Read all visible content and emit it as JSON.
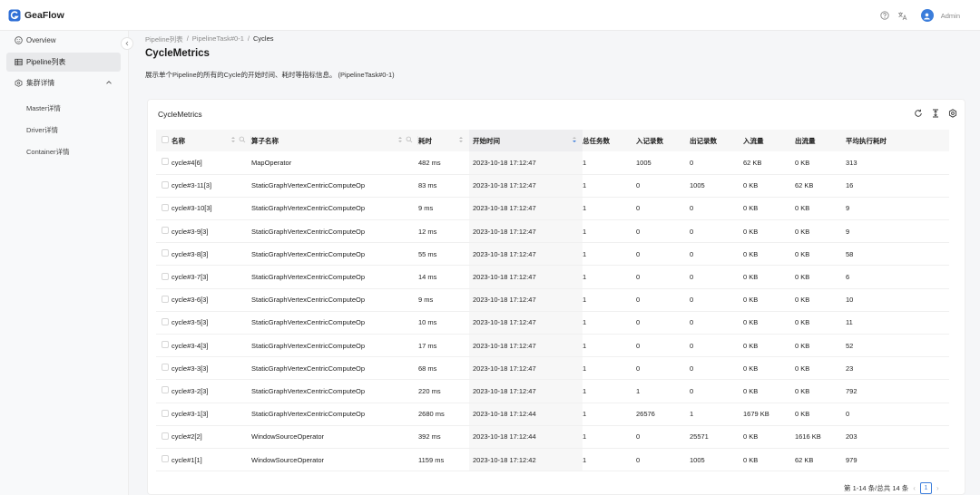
{
  "app": {
    "name": "GeaFlow"
  },
  "user": {
    "name": "Admin"
  },
  "sidebar": {
    "items": [
      {
        "label": "Overview",
        "icon": "smile-icon"
      },
      {
        "label": "Pipeline列表",
        "icon": "table-icon"
      },
      {
        "label": "集群详情",
        "icon": "cluster-icon"
      }
    ],
    "sub_items": [
      "Master详情",
      "Driver详情",
      "Container详情"
    ]
  },
  "breadcrumb": [
    "Pipeline列表",
    "PipelineTask#0-1",
    "Cycles"
  ],
  "page": {
    "title": "CycleMetrics",
    "description": "展示单个Pipeline的所有的Cycle的开始时间、耗时等指标信息。 (PipelineTask#0-1)"
  },
  "card": {
    "title": "CycleMetrics"
  },
  "table": {
    "headers": [
      "名称",
      "算子名称",
      "耗时",
      "开始时间",
      "总任务数",
      "入记录数",
      "出记录数",
      "入流量",
      "出流量",
      "平均执行耗时"
    ],
    "rows": [
      [
        "cycle#4[6]",
        "MapOperator",
        "482 ms",
        "2023-10-18 17:12:47",
        "1",
        "1005",
        "0",
        "62 KB",
        "0 KB",
        "313"
      ],
      [
        "cycle#3-11[3]",
        "StaticGraphVertexCentricComputeOp",
        "83 ms",
        "2023-10-18 17:12:47",
        "1",
        "0",
        "1005",
        "0 KB",
        "62 KB",
        "16"
      ],
      [
        "cycle#3-10[3]",
        "StaticGraphVertexCentricComputeOp",
        "9 ms",
        "2023-10-18 17:12:47",
        "1",
        "0",
        "0",
        "0 KB",
        "0 KB",
        "9"
      ],
      [
        "cycle#3-9[3]",
        "StaticGraphVertexCentricComputeOp",
        "12 ms",
        "2023-10-18 17:12:47",
        "1",
        "0",
        "0",
        "0 KB",
        "0 KB",
        "9"
      ],
      [
        "cycle#3-8[3]",
        "StaticGraphVertexCentricComputeOp",
        "55 ms",
        "2023-10-18 17:12:47",
        "1",
        "0",
        "0",
        "0 KB",
        "0 KB",
        "58"
      ],
      [
        "cycle#3-7[3]",
        "StaticGraphVertexCentricComputeOp",
        "14 ms",
        "2023-10-18 17:12:47",
        "1",
        "0",
        "0",
        "0 KB",
        "0 KB",
        "6"
      ],
      [
        "cycle#3-6[3]",
        "StaticGraphVertexCentricComputeOp",
        "9 ms",
        "2023-10-18 17:12:47",
        "1",
        "0",
        "0",
        "0 KB",
        "0 KB",
        "10"
      ],
      [
        "cycle#3-5[3]",
        "StaticGraphVertexCentricComputeOp",
        "10 ms",
        "2023-10-18 17:12:47",
        "1",
        "0",
        "0",
        "0 KB",
        "0 KB",
        "11"
      ],
      [
        "cycle#3-4[3]",
        "StaticGraphVertexCentricComputeOp",
        "17 ms",
        "2023-10-18 17:12:47",
        "1",
        "0",
        "0",
        "0 KB",
        "0 KB",
        "52"
      ],
      [
        "cycle#3-3[3]",
        "StaticGraphVertexCentricComputeOp",
        "68 ms",
        "2023-10-18 17:12:47",
        "1",
        "0",
        "0",
        "0 KB",
        "0 KB",
        "23"
      ],
      [
        "cycle#3-2[3]",
        "StaticGraphVertexCentricComputeOp",
        "220 ms",
        "2023-10-18 17:12:47",
        "1",
        "1",
        "0",
        "0 KB",
        "0 KB",
        "792"
      ],
      [
        "cycle#3-1[3]",
        "StaticGraphVertexCentricComputeOp",
        "2680 ms",
        "2023-10-18 17:12:44",
        "1",
        "26576",
        "1",
        "1679 KB",
        "0 KB",
        "0"
      ],
      [
        "cycle#2[2]",
        "WindowSourceOperator",
        "392 ms",
        "2023-10-18 17:12:44",
        "1",
        "0",
        "25571",
        "0 KB",
        "1616 KB",
        "203"
      ],
      [
        "cycle#1[1]",
        "WindowSourceOperator",
        "1159 ms",
        "2023-10-18 17:12:42",
        "1",
        "0",
        "1005",
        "0 KB",
        "62 KB",
        "979"
      ]
    ]
  },
  "pagination": {
    "summary": "第 1-14 条/总共 14 条",
    "current": "1"
  },
  "colors": {
    "accent": "#3b7ddb"
  }
}
